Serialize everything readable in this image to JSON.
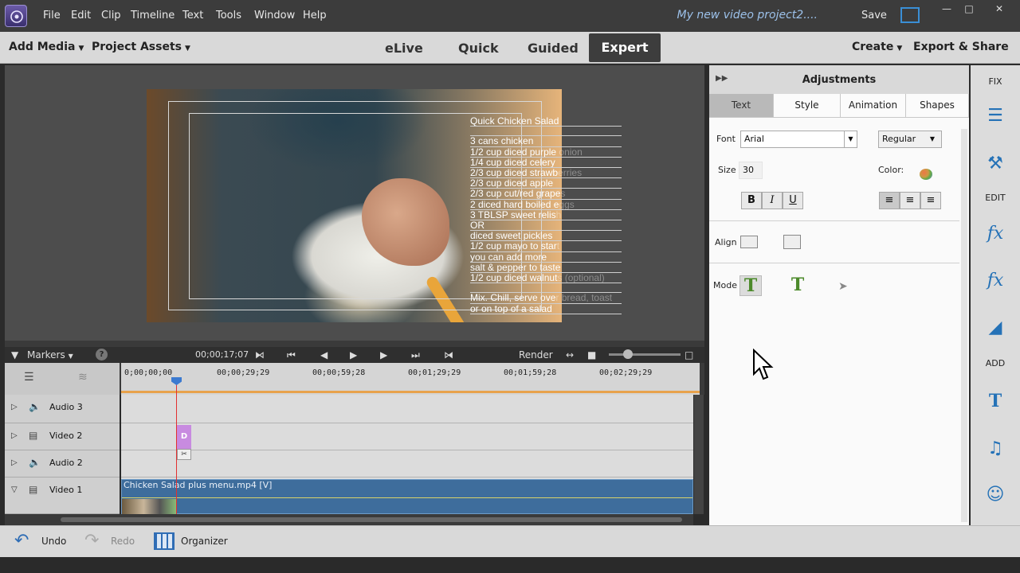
{
  "menubar": {
    "items": [
      "File",
      "Edit",
      "Clip",
      "Timeline",
      "Text",
      "Tools",
      "Window",
      "Help"
    ],
    "project_title": "My new video project2....",
    "save": "Save"
  },
  "header": {
    "add_media": "Add Media",
    "project_assets": "Project Assets",
    "tabs": [
      "eLive",
      "Quick",
      "Guided",
      "Expert"
    ],
    "active_tab": "Expert",
    "create": "Create",
    "export_share": "Export & Share"
  },
  "monitor": {
    "title_lines": [
      {
        "t": "Quick Chicken Salad",
        "g": ""
      },
      {
        "t": "",
        "g": ""
      },
      {
        "t": "3 cans chicken",
        "g": ""
      },
      {
        "t": "1/2 cup diced purple",
        "g": " onion"
      },
      {
        "t": "1/4 cup diced celery",
        "g": ""
      },
      {
        "t": "2/3 cup diced strawb",
        "g": "erries"
      },
      {
        "t": "2/3 cup diced apple",
        "g": ""
      },
      {
        "t": "2/3 cup cut/red grape",
        "g": "s"
      },
      {
        "t": "2 diced hard boiled e",
        "g": "ggs"
      },
      {
        "t": "3 TBLSP sweet relis",
        "g": "h"
      },
      {
        "t": "       OR",
        "g": ""
      },
      {
        "t": "diced sweet pickles",
        "g": ""
      },
      {
        "t": "1/2 cup mayo to star",
        "g": "t"
      },
      {
        "t": "   you can add more",
        "g": ""
      },
      {
        "t": "salt & pepper to taste",
        "g": ""
      },
      {
        "t": "1/2 cup diced walnut",
        "g": "s (optional)"
      },
      {
        "t": "",
        "g": ""
      },
      {
        "t": "Mix. Chill, serve ove",
        "g": "r bread, toast"
      },
      {
        "t": "or on top of a salad",
        "g": ""
      }
    ]
  },
  "timeline": {
    "markers": "Markers",
    "timecode": "00;00;17;07",
    "render": "Render",
    "ruler": [
      "0;00;00;00",
      "00;00;29;29",
      "00;00;59;28",
      "00;01;29;29",
      "00;01;59;28",
      "00;02;29;29"
    ],
    "tracks": [
      {
        "name": "Audio 3",
        "icon": "speaker"
      },
      {
        "name": "Video 2",
        "icon": "film"
      },
      {
        "name": "Audio 2",
        "icon": "speaker"
      },
      {
        "name": "Video 1",
        "icon": "film"
      }
    ],
    "clip_v1": "Chicken Salad plus menu.mp4 [V]",
    "title_clip_letter": "D"
  },
  "adjustments": {
    "title": "Adjustments",
    "tabs": [
      "Text",
      "Style",
      "Animation",
      "Shapes"
    ],
    "active_tab": "Text",
    "font_label": "Font",
    "font": "Arial",
    "weight": "Regular",
    "size_label": "Size",
    "size": "30",
    "color_label": "Color:",
    "bold": "B",
    "italic": "I",
    "underline": "U",
    "align_label": "Align",
    "mode_label": "Mode"
  },
  "rail": {
    "fix": "FIX",
    "edit": "EDIT",
    "add": "ADD"
  },
  "bottom": {
    "undo": "Undo",
    "redo": "Redo",
    "organizer": "Organizer"
  },
  "colors": {
    "accent": "#2572b7",
    "clip_blue": "#3e6d9c",
    "title_clip": "#c88be0",
    "playhead": "#e23030"
  }
}
